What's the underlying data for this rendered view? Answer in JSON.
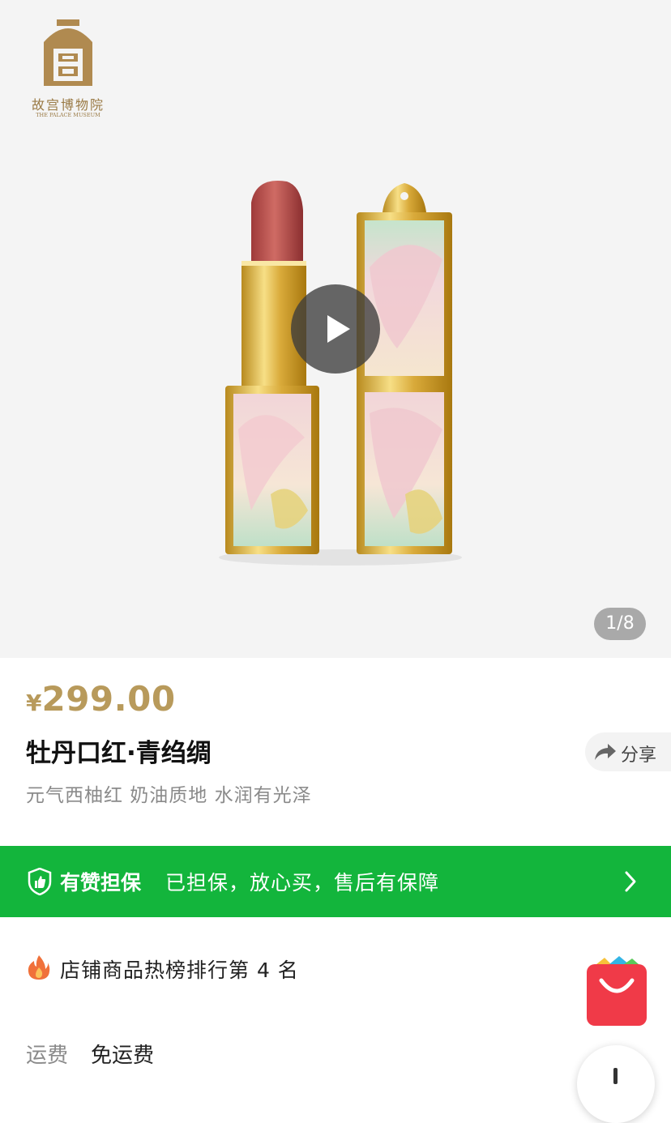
{
  "hero": {
    "logo": {
      "name": "故宫博物院",
      "name_en": "THE PALACE MUSEUM"
    },
    "image_counter": "1/8"
  },
  "product": {
    "currency_symbol": "¥",
    "price": "299.00",
    "title": "牡丹口红·青绉绸",
    "subtitle": "元气西柚红 奶油质地 水润有光泽",
    "share_label": "分享"
  },
  "guarantee": {
    "brand": "有赞担保",
    "text": "已担保，放心买，售后有保障"
  },
  "ranking": {
    "text": "店铺商品热榜排行第 4 名"
  },
  "shipping": {
    "label": "运费",
    "value": "免运费"
  },
  "colors": {
    "price_gold": "#b89a5b",
    "guarantee_green": "#13b53c",
    "cart_red": "#f03a48"
  },
  "icons": [
    "palace-museum-logo",
    "play-icon",
    "share-icon",
    "shield-thumb-icon",
    "chevron-right-icon",
    "fire-icon",
    "shop-bag-icon"
  ]
}
